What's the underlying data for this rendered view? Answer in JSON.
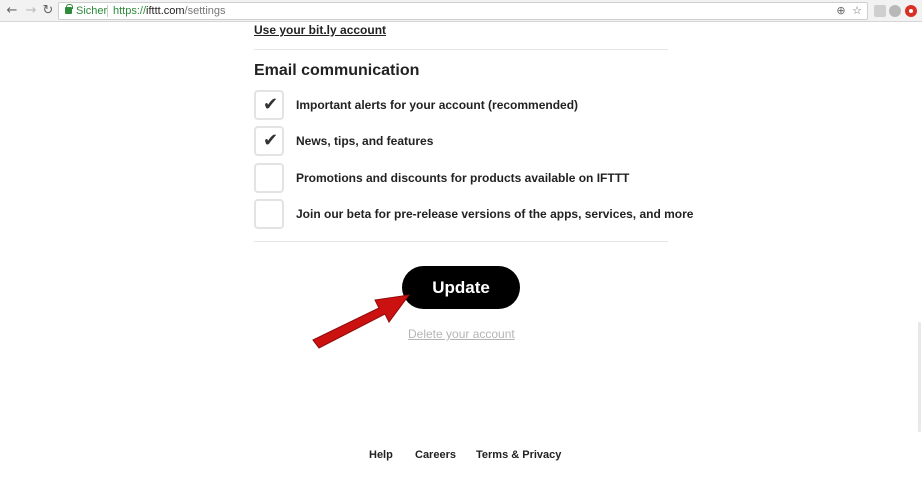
{
  "browser": {
    "secure_label": "Sicher",
    "url_scheme": "https://",
    "url_host": "ifttt.com",
    "url_path": "/settings",
    "icons": [
      "back-icon",
      "forward-icon",
      "reload-icon",
      "lock-icon",
      "translate-icon",
      "star-icon"
    ]
  },
  "settings": {
    "bitly_link": "Use your bit.ly account",
    "email_section_title": "Email communication",
    "preferences": [
      {
        "label": "Important alerts for your account (recommended)",
        "checked": true,
        "check_glyph": "✔"
      },
      {
        "label": "News, tips, and features",
        "checked": true,
        "check_glyph": "✔"
      },
      {
        "label": "Promotions and discounts for products available on IFTTT",
        "checked": false,
        "check_glyph": ""
      },
      {
        "label": "Join our beta for pre-release versions of the apps, services, and more",
        "checked": false,
        "check_glyph": ""
      }
    ],
    "update_button": "Update",
    "delete_link": "Delete your account"
  },
  "footer": {
    "help": "Help",
    "careers": "Careers",
    "terms": "Terms & Privacy"
  },
  "colors": {
    "accent_button": "#000000",
    "annotation_arrow": "#cc1111",
    "secure_green": "#2e8b3a"
  }
}
